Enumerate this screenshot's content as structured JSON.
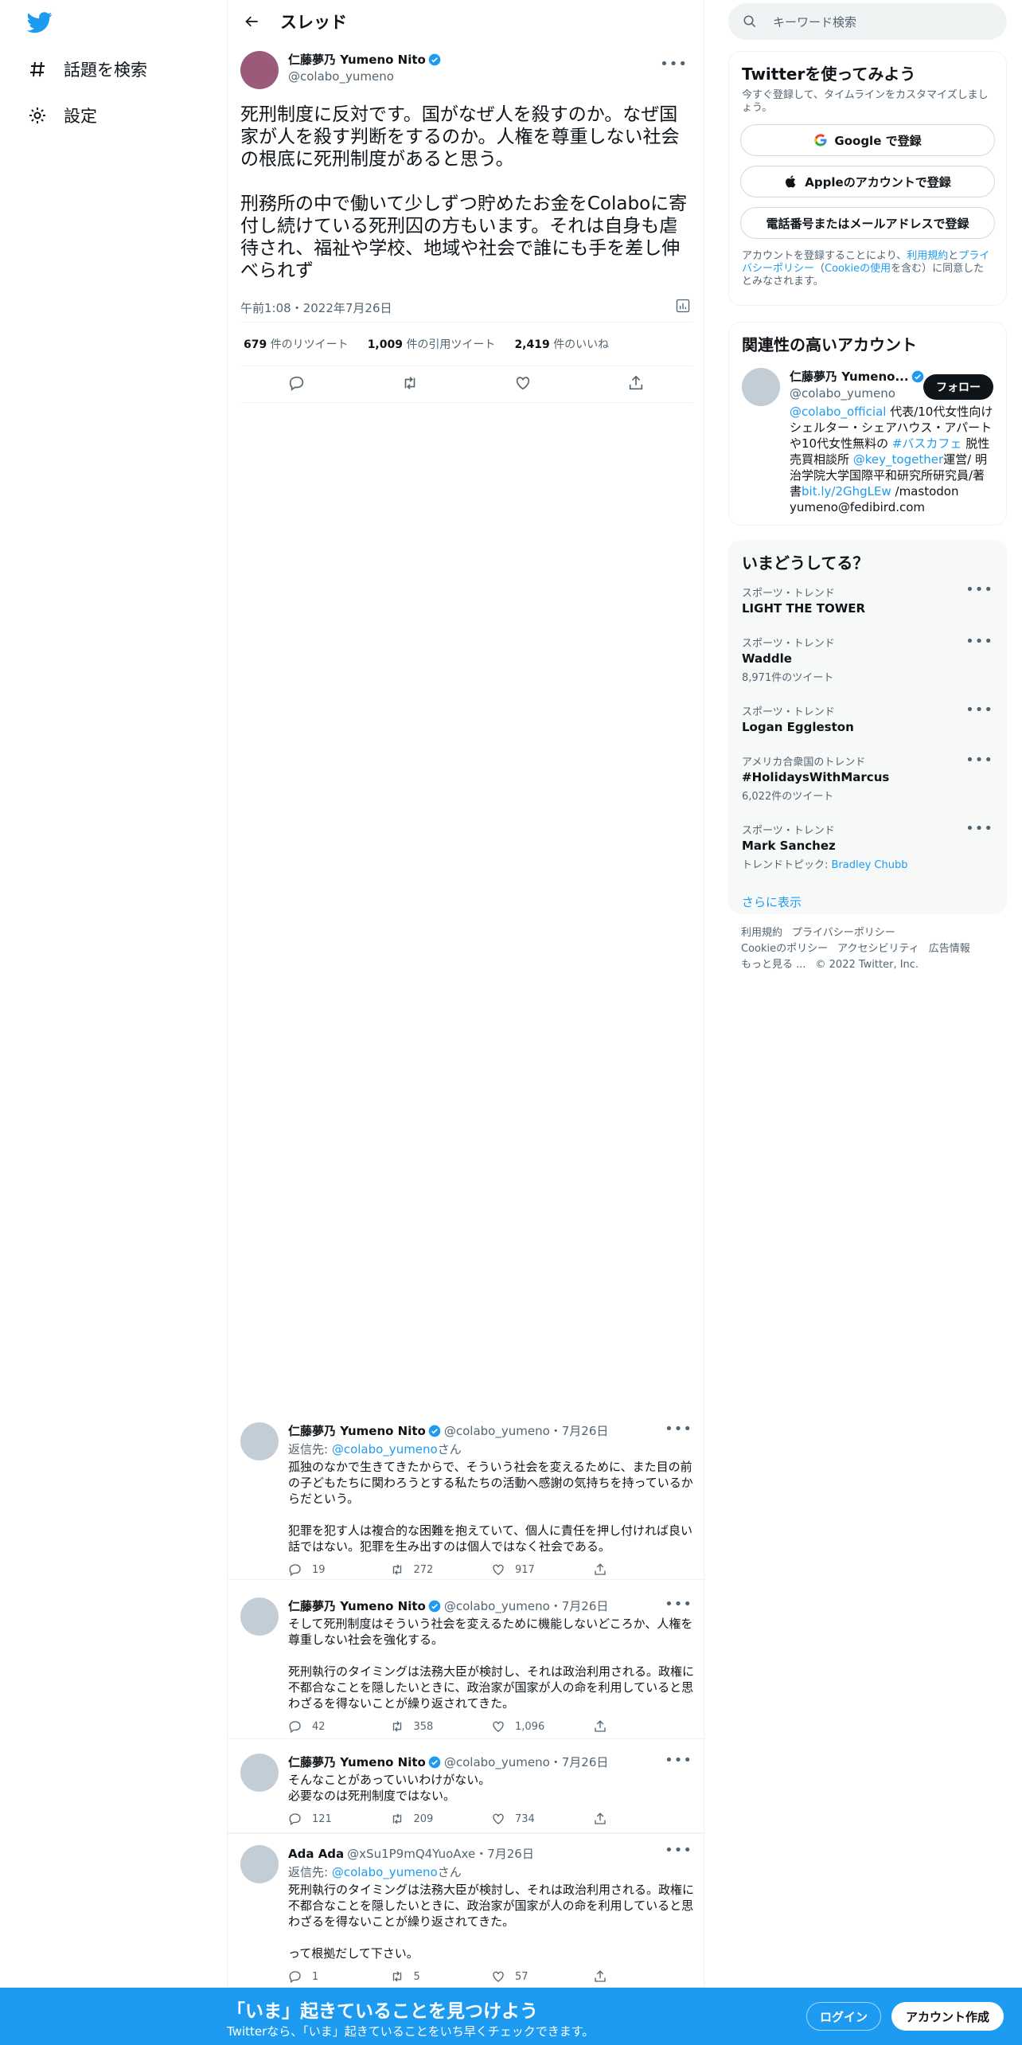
{
  "nav": {
    "explore_label": "話題を検索",
    "settings_label": "設定"
  },
  "header": {
    "title": "スレッド"
  },
  "main_tweet": {
    "name": "仁藤夢乃 Yumeno Nito",
    "handle": "@colabo_yumeno",
    "text": "死刑制度に反対です。国がなぜ人を殺すのか。なぜ国家が人を殺す判断をするのか。人権を尊重しない社会の根底に死刑制度があると思う。\n\n刑務所の中で働いて少しずつ貯めたお金をColaboに寄付し続けている死刑囚の方もいます。それは自身も虐待され、福祉や学校、地域や社会で誰にも手を差し伸べられず",
    "timestamp": "午前1:08・2022年7月26日",
    "retweets": "679",
    "retweets_label": "件のリツイート",
    "quotes": "1,009",
    "quotes_label": "件の引用ツイート",
    "likes": "2,419",
    "likes_label": "件のいいね"
  },
  "replies": [
    {
      "name": "仁藤夢乃 Yumeno Nito",
      "meta": "@colabo_yumeno・7月26日",
      "reply_prefix": "返信先: ",
      "reply_handle": "@colabo_yumeno",
      "reply_suffix": "さん",
      "text": "孤独のなかで生きてきたからで、そういう社会を変えるために、また目の前の子どもたちに関わろうとする私たちの活動へ感謝の気持ちを持っているからだという。\n\n犯罪を犯す人は複合的な困難を抱えていて、個人に責任を押し付ければ良い話ではない。犯罪を生み出すのは個人ではなく社会である。",
      "replies": "19",
      "retweets": "272",
      "likes": "917"
    },
    {
      "name": "仁藤夢乃 Yumeno Nito",
      "meta": "@colabo_yumeno・7月26日",
      "text": "そして死刑制度はそういう社会を変えるために機能しないどころか、人権を尊重しない社会を強化する。\n\n死刑執行のタイミングは法務大臣が検討し、それは政治利用される。政権に不都合なことを隠したいときに、政治家が国家が人の命を利用していると思わざるを得ないことが繰り返されてきた。",
      "replies": "42",
      "retweets": "358",
      "likes": "1,096"
    },
    {
      "name": "仁藤夢乃 Yumeno Nito",
      "meta": "@colabo_yumeno・7月26日",
      "text": "そんなことがあっていいわけがない。\n必要なのは死刑制度ではない。",
      "replies": "121",
      "retweets": "209",
      "likes": "734"
    },
    {
      "name": "Ada Ada",
      "meta": "@xSu1P9mQ4YuoAxe・7月26日",
      "reply_prefix": "返信先: ",
      "reply_handle": "@colabo_yumeno",
      "reply_suffix": "さん",
      "text": "死刑執行のタイミングは法務大臣が検討し、それは政治利用される。政権に不都合なことを隠したいときに、政治家が国家が人の命を利用していると思わざるを得ないことが繰り返されてきた。\n\nって根拠だして下さい。",
      "replies": "1",
      "retweets": "5",
      "likes": "57"
    }
  ],
  "search": {
    "placeholder": "キーワード検索"
  },
  "signup_panel": {
    "title": "Twitterを使ってみよう",
    "subtitle": "今すぐ登録して、タイムラインをカスタマイズしましょう。",
    "google_label": "Google で登録",
    "apple_label": "Appleのアカウントで登録",
    "phone_label": "電話番号またはメールアドレスで登録",
    "terms_prefix": "アカウントを登録することにより、",
    "terms_link1": "利用規約",
    "terms_and": "と",
    "terms_link2": "プライバシーポリシー",
    "terms_mid": "（",
    "terms_link3": "Cookieの使用",
    "terms_suffix": "を含む）に同意したとみなされます。"
  },
  "related": {
    "title": "関連性の高いアカウント",
    "name": "仁藤夢乃 Yumeno...",
    "handle": "@colabo_yumeno",
    "follow_label": "フォロー",
    "bio_link1": "@colabo_official",
    "bio_part1": " 代表/10代女性向けシェルター・シェアハウス・アパートや10代女性無料の ",
    "bio_link2": "#バスカフェ",
    "bio_part2": " 脱性売買相談所 ",
    "bio_link3": "@key_together",
    "bio_part3": "運営/ 明治学院大学国際平和研究所研究員/著書",
    "bio_link4": "bit.ly/2GhgLEw",
    "bio_part4": " /mastodon yumeno@fedibird.com"
  },
  "trends": {
    "title": "いまどうしてる？",
    "items": [
      {
        "category": "スポーツ・トレンド",
        "name": "LIGHT THE TOWER",
        "count": ""
      },
      {
        "category": "スポーツ・トレンド",
        "name": "Waddle",
        "count": "8,971件のツイート"
      },
      {
        "category": "スポーツ・トレンド",
        "name": "Logan Eggleston",
        "count": ""
      },
      {
        "category": "アメリカ合衆国のトレンド",
        "name": "#HolidaysWithMarcus",
        "count": "6,022件のツイート"
      },
      {
        "category": "スポーツ・トレンド",
        "name": "Mark Sanchez",
        "count": ""
      }
    ],
    "topic_prefix": "トレンドトピック: ",
    "topic_link": "Bradley Chubb",
    "show_more": "さらに表示"
  },
  "footer": {
    "terms": "利用規約",
    "privacy": "プライバシーポリシー",
    "cookies": "Cookieのポリシー",
    "accessibility": "アクセシビリティ",
    "ads": "広告情報",
    "more": "もっと見る ...",
    "copyright": "© 2022 Twitter, Inc."
  },
  "bottom_bar": {
    "title": "「いま」起きていることを見つけよう",
    "subtitle": "Twitterなら、「いま」起きていることをいち早くチェックできます。",
    "login_label": "ログイン",
    "signup_label": "アカウント作成"
  },
  "colors": {
    "brand": "#1d9bf0",
    "text": "#0f1419",
    "secondary": "#536471"
  }
}
